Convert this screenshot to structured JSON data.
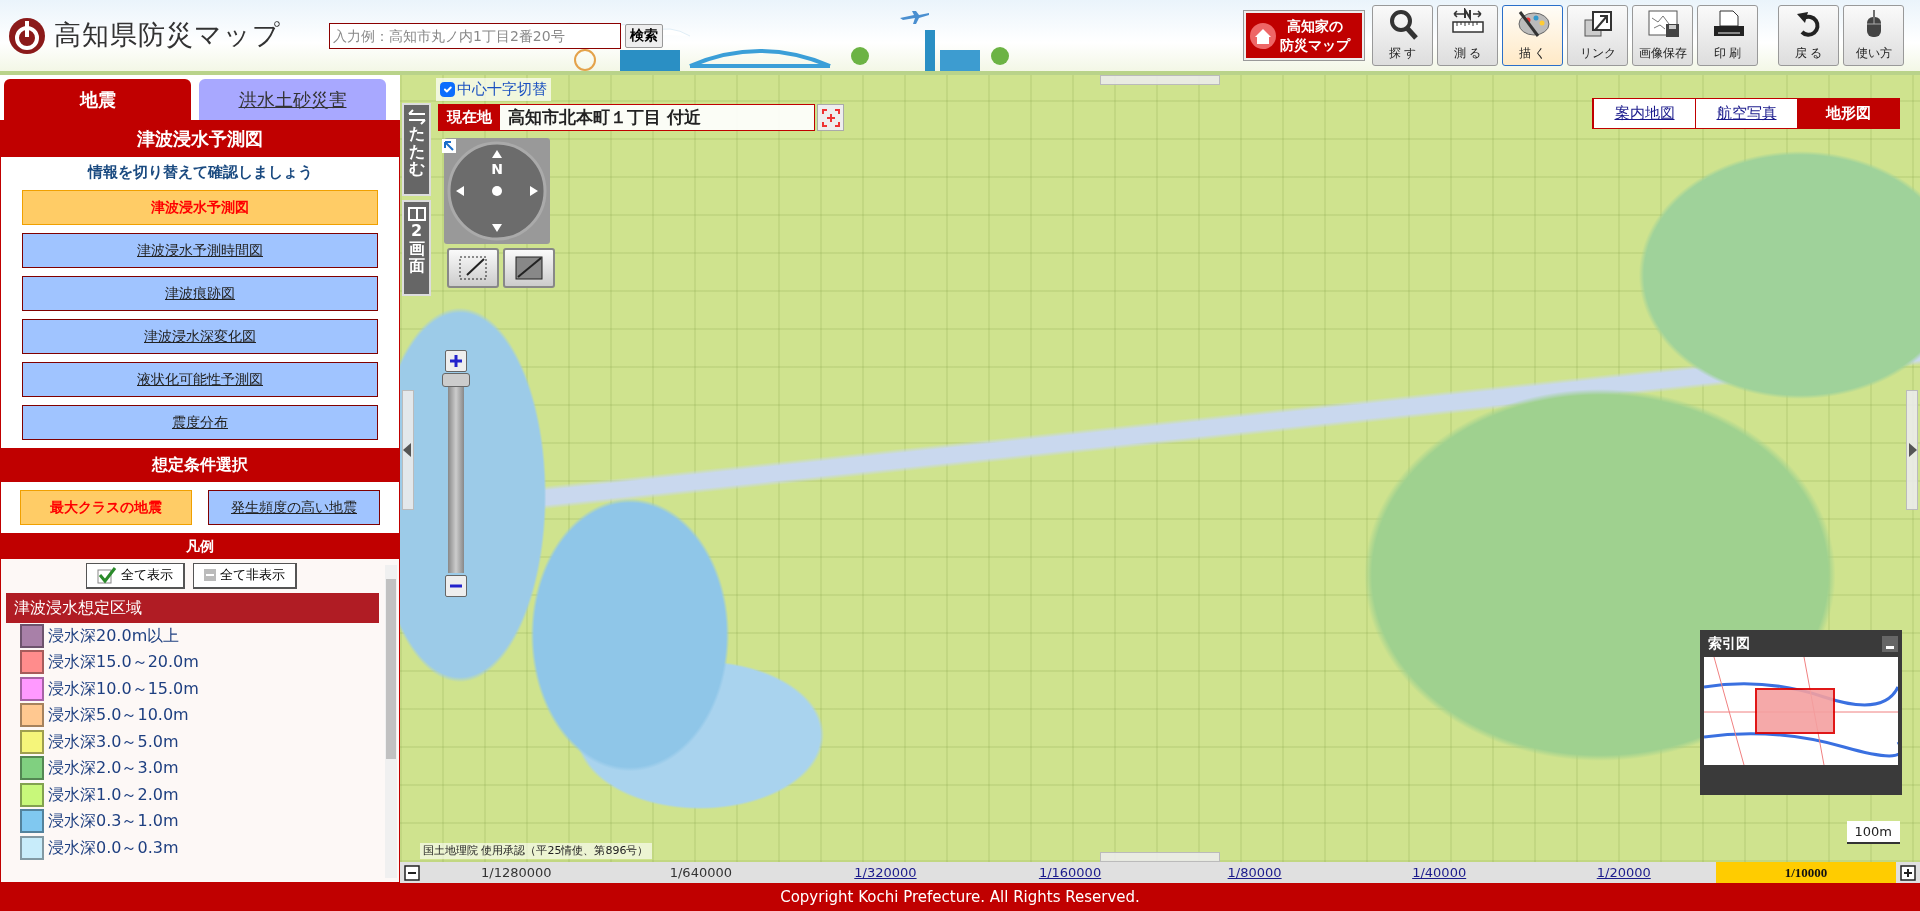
{
  "header": {
    "logo_text": "高知県防災マップ",
    "search": {
      "placeholder": "入力例：高知市丸ノ内1丁目2番20号",
      "button": "検索"
    },
    "home_banner": {
      "line1": "高知家の",
      "line2": "防災マップ"
    },
    "tools": [
      {
        "kind": "search",
        "label": "探 す",
        "selected": false
      },
      {
        "kind": "measure",
        "label": "測 る",
        "selected": false
      },
      {
        "kind": "draw",
        "label": "描 く",
        "selected": true
      },
      {
        "kind": "link",
        "label": "リンク",
        "selected": false
      },
      {
        "kind": "save",
        "label": "画像保存",
        "selected": false
      },
      {
        "kind": "print",
        "label": "印 刷",
        "selected": false
      },
      {
        "kind": "back",
        "label": "戻 る",
        "selected": false
      },
      {
        "kind": "help",
        "label": "使い方",
        "selected": false
      }
    ]
  },
  "sidebar": {
    "tabs": [
      {
        "label": "地震",
        "selected": true
      },
      {
        "label": "洪水土砂災害",
        "selected": false
      }
    ],
    "section_title": "津波浸水予測図",
    "subtitle": "情報を切り替えて確認しましょう",
    "map_types": [
      {
        "label": "津波浸水予測図",
        "selected": true
      },
      {
        "label": "津波浸水予測時間図",
        "selected": false
      },
      {
        "label": "津波痕跡図",
        "selected": false
      },
      {
        "label": "津波浸水深変化図",
        "selected": false
      },
      {
        "label": "液状化可能性予測図",
        "selected": false
      },
      {
        "label": "震度分布",
        "selected": false
      }
    ],
    "conditions_title": "想定条件選択",
    "conditions": [
      {
        "label": "最大クラスの地震",
        "selected": true
      },
      {
        "label": "発生頻度の高い地震",
        "selected": false
      }
    ],
    "legend": {
      "title": "凡例",
      "show_all": "全て表示",
      "hide_all": "全て非表示",
      "group_title": "津波浸水想定区域",
      "items": [
        {
          "label": "浸水深20.0m以上",
          "color": "#a880a8"
        },
        {
          "label": "浸水深15.0～20.0m",
          "color": "#ff8c8c"
        },
        {
          "label": "浸水深10.0～15.0m",
          "color": "#ff99ff"
        },
        {
          "label": "浸水深5.0～10.0m",
          "color": "#ffc890"
        },
        {
          "label": "浸水深3.0～5.0m",
          "color": "#f5f57a"
        },
        {
          "label": "浸水深2.0～3.0m",
          "color": "#80d080"
        },
        {
          "label": "浸水深1.0～2.0m",
          "color": "#c8f87a"
        },
        {
          "label": "浸水深0.3～1.0m",
          "color": "#80c8f0"
        },
        {
          "label": "浸水深0.0～0.3m",
          "color": "#c8ecfa"
        }
      ]
    }
  },
  "map": {
    "center_crosshair": {
      "label": "中心十字切替",
      "checked": true
    },
    "side_buttons": [
      {
        "kind": "collapse",
        "label": "たたむ"
      },
      {
        "kind": "split",
        "label": "2画面"
      }
    ],
    "location": {
      "label": "現在地",
      "address": "高知市北本町１丁目 付近"
    },
    "compass": {
      "north_label": "N"
    },
    "zoom_slider": {
      "level": 1
    },
    "layers": [
      {
        "label": "案内地図",
        "selected": false
      },
      {
        "label": "航空写真",
        "selected": false
      },
      {
        "label": "地形図",
        "selected": true
      }
    ],
    "index_map": {
      "title": "索引図"
    },
    "scale_bar": "100m",
    "attribution": "国土地理院 使用承認（平25情使、第896号）"
  },
  "scales": [
    {
      "label": "1/1280000",
      "disabled": true,
      "selected": false
    },
    {
      "label": "1/640000",
      "disabled": true,
      "selected": false
    },
    {
      "label": "1/320000",
      "disabled": false,
      "selected": false
    },
    {
      "label": "1/160000",
      "disabled": false,
      "selected": false
    },
    {
      "label": "1/80000",
      "disabled": false,
      "selected": false
    },
    {
      "label": "1/40000",
      "disabled": false,
      "selected": false
    },
    {
      "label": "1/20000",
      "disabled": false,
      "selected": false
    },
    {
      "label": "1/10000",
      "disabled": false,
      "selected": true
    }
  ],
  "footer": "Copyright Kochi Prefecture. All Rights Reserved."
}
